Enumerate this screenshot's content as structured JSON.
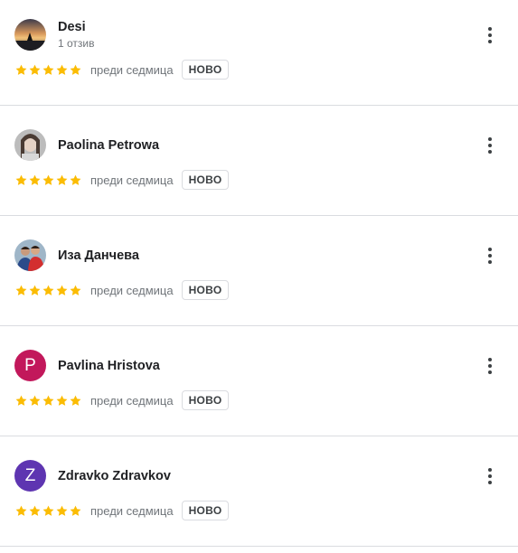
{
  "reviews": [
    {
      "name": "Desi",
      "subline": "1 отзив",
      "avatar_type": "photo",
      "rating": 5,
      "time": "преди седмица",
      "badge": "НОВО"
    },
    {
      "name": "Paolina Petrowa",
      "avatar_type": "photo",
      "rating": 5,
      "time": "преди седмица",
      "badge": "НОВО"
    },
    {
      "name": "Иза Данчева",
      "avatar_type": "photo",
      "rating": 5,
      "time": "преди седмица",
      "badge": "НОВО"
    },
    {
      "name": "Pavlina Hristova",
      "avatar_type": "letter",
      "avatar_letter": "P",
      "avatar_color": "#c2185b",
      "rating": 5,
      "time": "преди седмица",
      "badge": "НОВО"
    },
    {
      "name": "Zdravko Zdravkov",
      "avatar_type": "letter",
      "avatar_letter": "Z",
      "avatar_color": "#5e35b1",
      "rating": 5,
      "time": "преди седмица",
      "badge": "НОВО"
    }
  ],
  "colors": {
    "star": "#fbbc04",
    "divider": "#dadce0",
    "secondary_text": "#70757a"
  },
  "icons": {
    "star": "star-icon",
    "more": "more-vert-icon"
  }
}
